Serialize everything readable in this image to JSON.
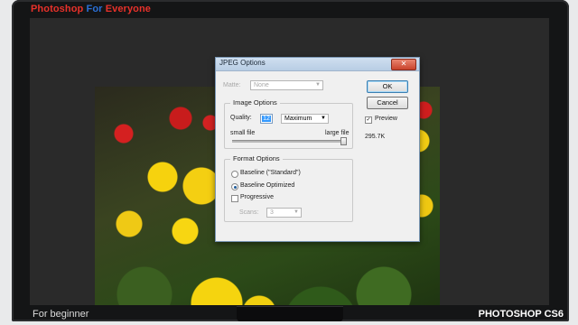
{
  "banner": {
    "part1": "Photoshop",
    "part2": "For",
    "part3": "Everyone"
  },
  "footer": {
    "left": "For beginner",
    "right": "PHOTOSHOP CS6"
  },
  "dialog": {
    "title": "JPEG Options",
    "close_glyph": "✕",
    "matte": {
      "label": "Matte:",
      "value": "None"
    },
    "image_options": {
      "title": "Image Options",
      "quality_label": "Quality:",
      "quality_value": "12",
      "quality_preset": "Maximum",
      "small_label": "small file",
      "large_label": "large file",
      "slider_level": 1.0
    },
    "format_options": {
      "title": "Format Options",
      "choices": [
        "Baseline (\"Standard\")",
        "Baseline Optimized",
        "Progressive"
      ],
      "selected_index": 1,
      "scans_label": "Scans:",
      "scans_value": "3"
    },
    "ok_label": "OK",
    "cancel_label": "Cancel",
    "preview_label": "Preview",
    "preview_checked": true,
    "file_size": "295.7K"
  },
  "colors": {
    "accent_red": "#e8312a",
    "accent_blue": "#2a6fd6"
  }
}
